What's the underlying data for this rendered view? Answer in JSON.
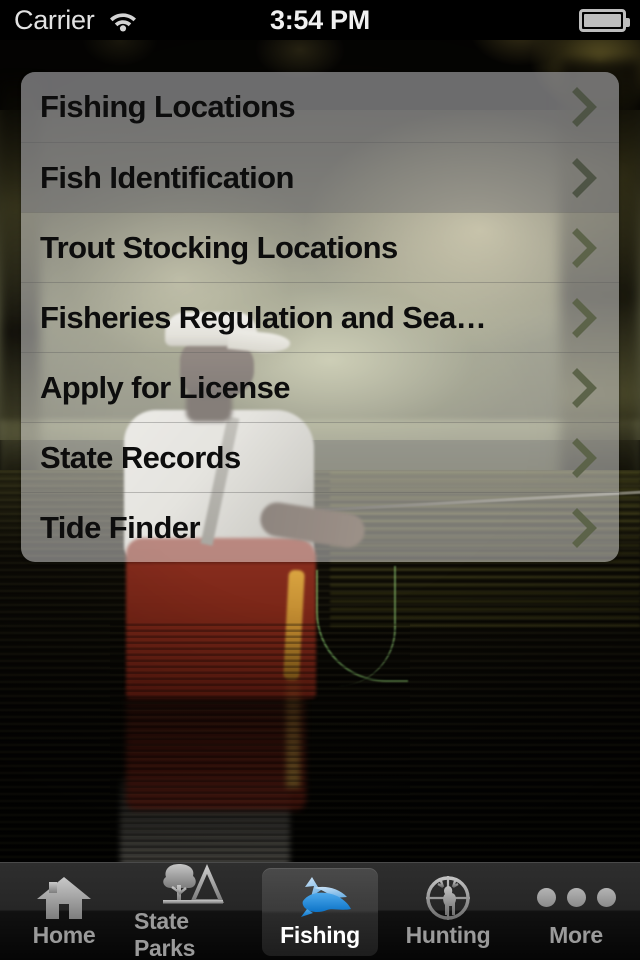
{
  "status_bar": {
    "carrier": "Carrier",
    "wifi_icon": "wifi-icon",
    "time": "3:54 PM",
    "battery_icon": "battery-icon"
  },
  "menu": {
    "items": [
      {
        "label": "Fishing Locations",
        "accessory": "chevron-right-icon",
        "highlighted": true
      },
      {
        "label": "Fish Identification",
        "accessory": "chevron-right-icon",
        "highlighted": true
      },
      {
        "label": "Trout Stocking Locations",
        "accessory": "chevron-right-icon",
        "highlighted": false
      },
      {
        "label": "Fisheries Regulation and Sea…",
        "accessory": "chevron-right-icon",
        "highlighted": false
      },
      {
        "label": "Apply for License",
        "accessory": "chevron-right-icon",
        "highlighted": false
      },
      {
        "label": "State Records",
        "accessory": "chevron-right-icon",
        "highlighted": false
      },
      {
        "label": "Tide Finder",
        "accessory": "chevron-right-icon",
        "highlighted": false
      }
    ]
  },
  "tab_bar": {
    "tabs": [
      {
        "label": "Home",
        "icon": "house-icon",
        "active": false
      },
      {
        "label": "State Parks",
        "icon": "tree-tent-icon",
        "active": false
      },
      {
        "label": "Fishing",
        "icon": "fish-icon",
        "active": true
      },
      {
        "label": "Hunting",
        "icon": "deer-crosshair-icon",
        "active": false
      },
      {
        "label": "More",
        "icon": "ellipsis-icon",
        "active": false
      }
    ]
  },
  "background": {
    "description": "blurred photograph of an angler fly fishing in a lake",
    "accent_color": "#2e9bdf"
  }
}
